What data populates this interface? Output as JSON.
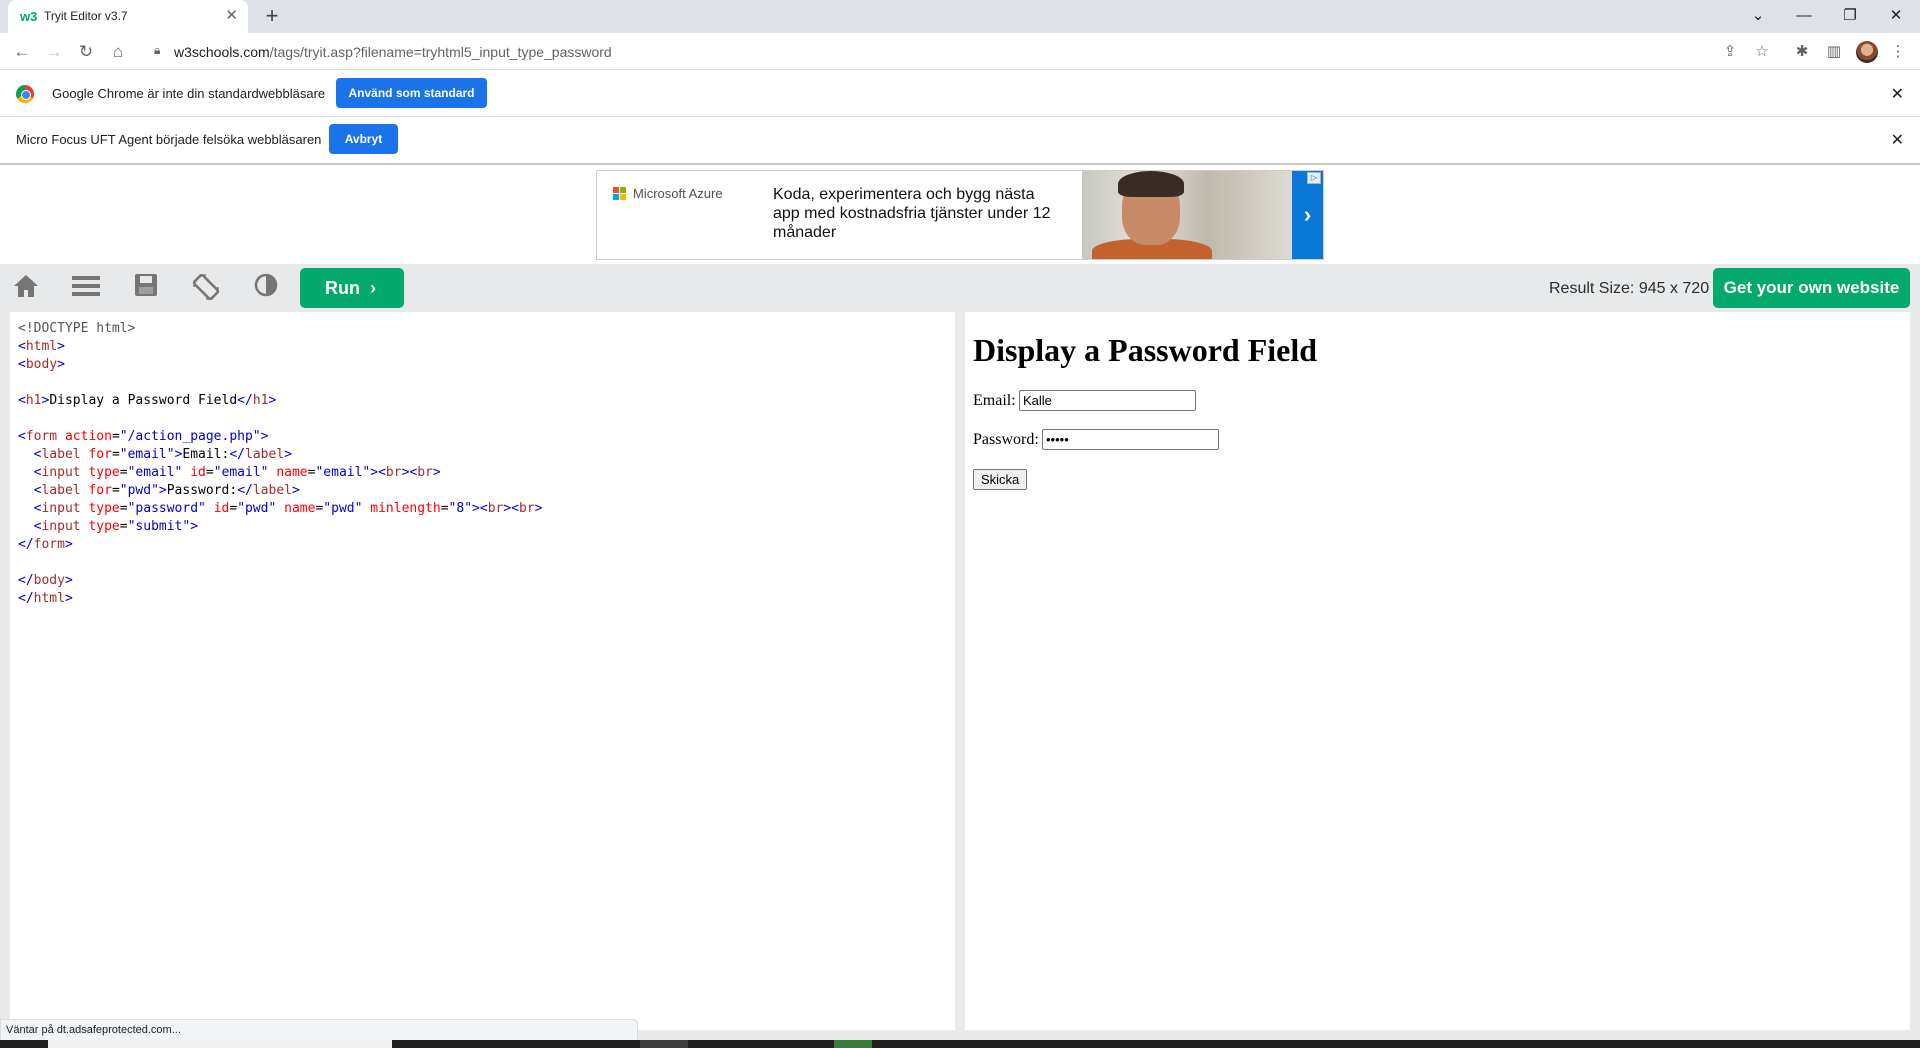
{
  "browser": {
    "tab_title": "Tryit Editor v3.7",
    "tab_favicon": "w3",
    "url_host": "w3schools.com",
    "url_path": "/tags/tryit.asp?filename=tryhtml5_input_type_password"
  },
  "infobars": {
    "default_browser_text": "Google Chrome är inte din standardwebbläsare",
    "default_browser_button": "Använd som standard",
    "debug_text": "Micro Focus UFT Agent började felsöka webbläsaren",
    "debug_button": "Avbryt"
  },
  "ad": {
    "brand": "Microsoft Azure",
    "copy": "Koda, experimentera och bygg nästa app med kostnadsfria tjänster under 12 månader",
    "arrow": "›"
  },
  "tryit": {
    "run_label": "Run",
    "run_chevron": "›",
    "result_size": "Result Size: 945 x 720",
    "get_website": "Get your own website"
  },
  "result": {
    "heading": "Display a Password Field",
    "email_label": "Email:",
    "email_value": "Kalle",
    "password_label": "Password:",
    "password_value": "•••••",
    "submit_label": "Skicka"
  },
  "status_text": "Väntar på dt.adsafeprotected.com...",
  "colors": {
    "w3_green": "#04aa6d",
    "chrome_blue": "#1a73e8",
    "azure_blue": "#0a78d7"
  }
}
